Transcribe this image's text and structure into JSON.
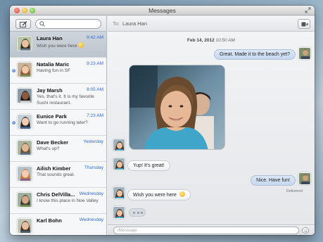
{
  "window": {
    "title": "Messages"
  },
  "sidebar": {
    "search": {
      "placeholder": "",
      "value": ""
    },
    "conversations": [
      {
        "name": "Laura Han",
        "time": "9:42 AM",
        "preview": "Wish you were here",
        "selected": true,
        "unread": false,
        "has_emoji": true
      },
      {
        "name": "Natalia Maric",
        "time": "9:23 AM",
        "preview": "Having fun in SF",
        "selected": false,
        "unread": true,
        "has_emoji": false
      },
      {
        "name": "Jay Marsh",
        "time": "8:05 AM",
        "preview": "Yes, that's it. It is my favorite Sushi restaurant.",
        "selected": false,
        "unread": false,
        "has_emoji": false
      },
      {
        "name": "Eunice Park",
        "time": "7:23 AM",
        "preview": "Want to go running later?",
        "selected": false,
        "unread": true,
        "has_emoji": false
      },
      {
        "name": "Dave Becker",
        "time": "Yesterday",
        "preview": "What's up?",
        "selected": false,
        "unread": false,
        "has_emoji": false
      },
      {
        "name": "Ailish Kimber",
        "time": "Thursday",
        "preview": "That sounds great.",
        "selected": false,
        "unread": false,
        "has_emoji": false
      },
      {
        "name": "Chris DelVilla...",
        "time": "Wednesday",
        "preview": "I know this place in Noe Valley",
        "selected": false,
        "unread": false,
        "has_emoji": false
      },
      {
        "name": "Karl Bohn",
        "time": "Wednesday",
        "preview": "",
        "selected": false,
        "unread": false,
        "has_emoji": false
      }
    ]
  },
  "chat": {
    "to_label": "To:",
    "recipient": "Laura Han",
    "date_stamp": {
      "date": "Feb 14, 2012",
      "time": "10:50 AM"
    },
    "messages": [
      {
        "direction": "out",
        "text": "Great. Made it to the beach yet?"
      },
      {
        "direction": "in",
        "type": "photo"
      },
      {
        "direction": "in",
        "text": "Yup! It's great!"
      },
      {
        "direction": "out",
        "text": "Nice. Have fun!"
      },
      {
        "direction": "in",
        "text": "Wish you were here"
      }
    ],
    "delivered_label": "Delivered",
    "input": {
      "placeholder": "iMessage",
      "value": ""
    }
  },
  "colors": {
    "accent_blue": "#2f6ad0",
    "unread_dot": "#3e6fc6",
    "out_bubble": "#c6d8ef",
    "in_bubble": "#ffffff",
    "selected_row": "#c4ccd4"
  },
  "icons": [
    "compose-icon",
    "search-icon",
    "video-call-icon",
    "emoji-icon",
    "fullscreen-icon"
  ]
}
